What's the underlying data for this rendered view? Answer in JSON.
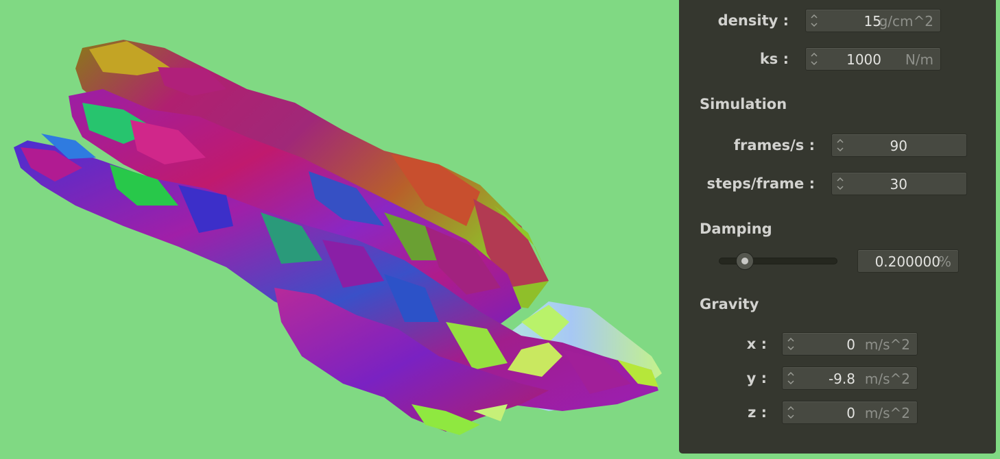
{
  "physics": {
    "density": {
      "label": "density :",
      "value": "15",
      "unit": "g/cm^2"
    },
    "ks": {
      "label": "ks :",
      "value": "1000",
      "unit": "N/m"
    }
  },
  "simulation": {
    "title": "Simulation",
    "frames": {
      "label": "frames/s :",
      "value": "90"
    },
    "steps": {
      "label": "steps/frame :",
      "value": "30"
    }
  },
  "damping": {
    "title": "Damping",
    "value": "0.200000",
    "unit": "%",
    "slider_fraction": 0.2
  },
  "gravity": {
    "title": "Gravity",
    "x": {
      "label": "x :",
      "value": "0",
      "unit": "m/s^2"
    },
    "y": {
      "label": "y :",
      "value": "-9.8",
      "unit": "m/s^2"
    },
    "z": {
      "label": "z :",
      "value": "0",
      "unit": "m/s^2"
    }
  },
  "colors": {
    "background": "#80d983",
    "panel": "#35372f",
    "field": "#474941"
  }
}
